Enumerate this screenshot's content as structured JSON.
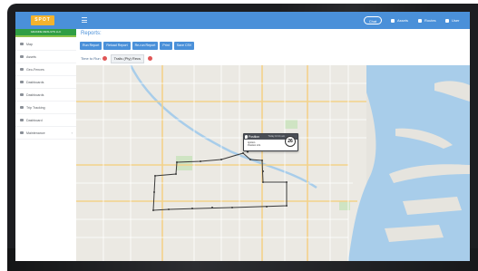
{
  "app": {
    "brand": "SPOT",
    "tagline": "GRANDE RESULTS LLC"
  },
  "sidebar": {
    "items": [
      {
        "label": "Map",
        "icon": "map-icon"
      },
      {
        "label": "Assets",
        "icon": "car-icon"
      },
      {
        "label": "Geo-Fences",
        "icon": "fence-icon"
      },
      {
        "label": "Dashboards",
        "icon": "dashboard-icon"
      },
      {
        "label": "Dashboards",
        "icon": "dashboard-icon"
      },
      {
        "label": "Trip Tracking",
        "icon": "route-icon"
      },
      {
        "label": "Dashboard",
        "icon": "dashboard-icon"
      },
      {
        "label": "Maintenance",
        "icon": "wrench-icon",
        "has_chevron": true
      }
    ]
  },
  "topbar": {
    "chat_label": "Chat",
    "items": [
      {
        "label": "Assets",
        "icon": "car-icon"
      },
      {
        "label": "Routes",
        "icon": "route-icon"
      },
      {
        "label": "User",
        "icon": "user-icon"
      }
    ]
  },
  "page": {
    "title": "Reports:",
    "toolbar": [
      "Run Report",
      "Reload Report",
      "Re-run Report",
      "Print",
      "Save CSV"
    ],
    "filters": {
      "chip1": "Time to Run",
      "chip2": "Trails (Pty) Recs"
    }
  },
  "popup": {
    "title": "Position",
    "datetime": "Today 10:21 am",
    "line1": "Ignition",
    "line2": "Position info",
    "speed": "26"
  },
  "colors": {
    "accent": "#4a90d9",
    "water": "#a8cdea",
    "land": "#e6e4de",
    "route": "#3a3a3a",
    "bezel": "#1c1d20"
  }
}
